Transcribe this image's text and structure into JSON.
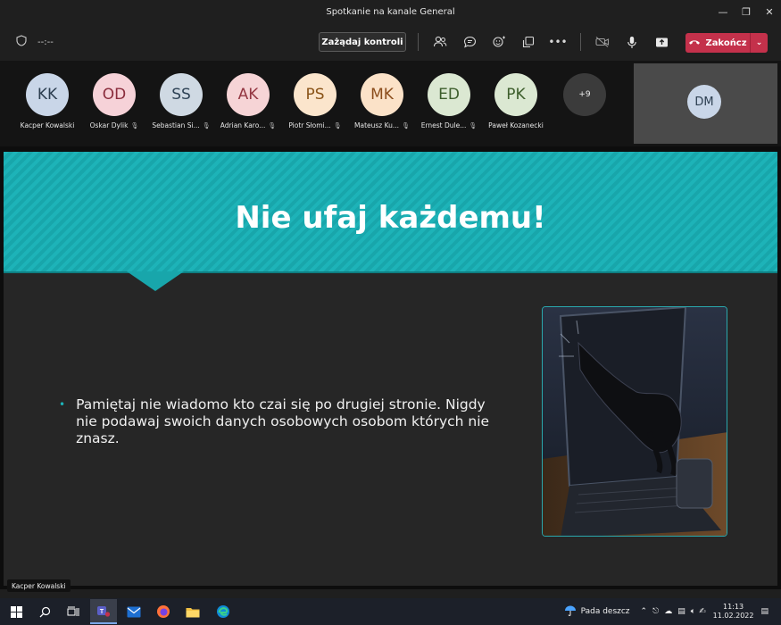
{
  "window": {
    "title": "Spotkanie na kanale General"
  },
  "toolbar": {
    "timer": "--:--",
    "request_control": "Zażądaj kontroli",
    "end_label": "Zakończ"
  },
  "participants": [
    {
      "initials": "KK",
      "name": "Kacper Kowalski",
      "muted": false,
      "bg": "#c9d6e8",
      "fg": "#2c3e50"
    },
    {
      "initials": "OD",
      "name": "Oskar Dylik",
      "muted": true,
      "bg": "#f6d2d8",
      "fg": "#8a2c3c"
    },
    {
      "initials": "SS",
      "name": "Sebastian Si...",
      "muted": true,
      "bg": "#cfd9e3",
      "fg": "#2f4356"
    },
    {
      "initials": "AK",
      "name": "Adrian Karo...",
      "muted": true,
      "bg": "#f6d4d6",
      "fg": "#943742"
    },
    {
      "initials": "PS",
      "name": "Piotr Słomi...",
      "muted": true,
      "bg": "#fbe5cc",
      "fg": "#8a5418"
    },
    {
      "initials": "MK",
      "name": "Mateusz Ku...",
      "muted": true,
      "bg": "#fbe2c8",
      "fg": "#8b4d1c"
    },
    {
      "initials": "ED",
      "name": "Ernest Dule...",
      "muted": true,
      "bg": "#dbe8d2",
      "fg": "#3d5e2c"
    },
    {
      "initials": "PK",
      "name": "Paweł Kozanecki",
      "muted": false,
      "bg": "#dbe8d2",
      "fg": "#3d5e2c"
    }
  ],
  "more_count": "+9",
  "self": {
    "initials": "DM",
    "bg": "#c9d6e8",
    "fg": "#2c3e50"
  },
  "slide": {
    "title": "Nie ufaj każdemu!",
    "bullet": "Pamiętaj nie wiadomo kto czai się po drugiej stronie. Nigdy nie podawaj swoich danych osobowych osobom których nie znasz."
  },
  "presenter_tag": "Kacper Kowalski",
  "taskbar": {
    "weather": "Pada deszcz",
    "time": "11:13",
    "date": "11.02.2022"
  },
  "colors": {
    "accent": "#1db3b8",
    "end_button": "#c4314b"
  }
}
